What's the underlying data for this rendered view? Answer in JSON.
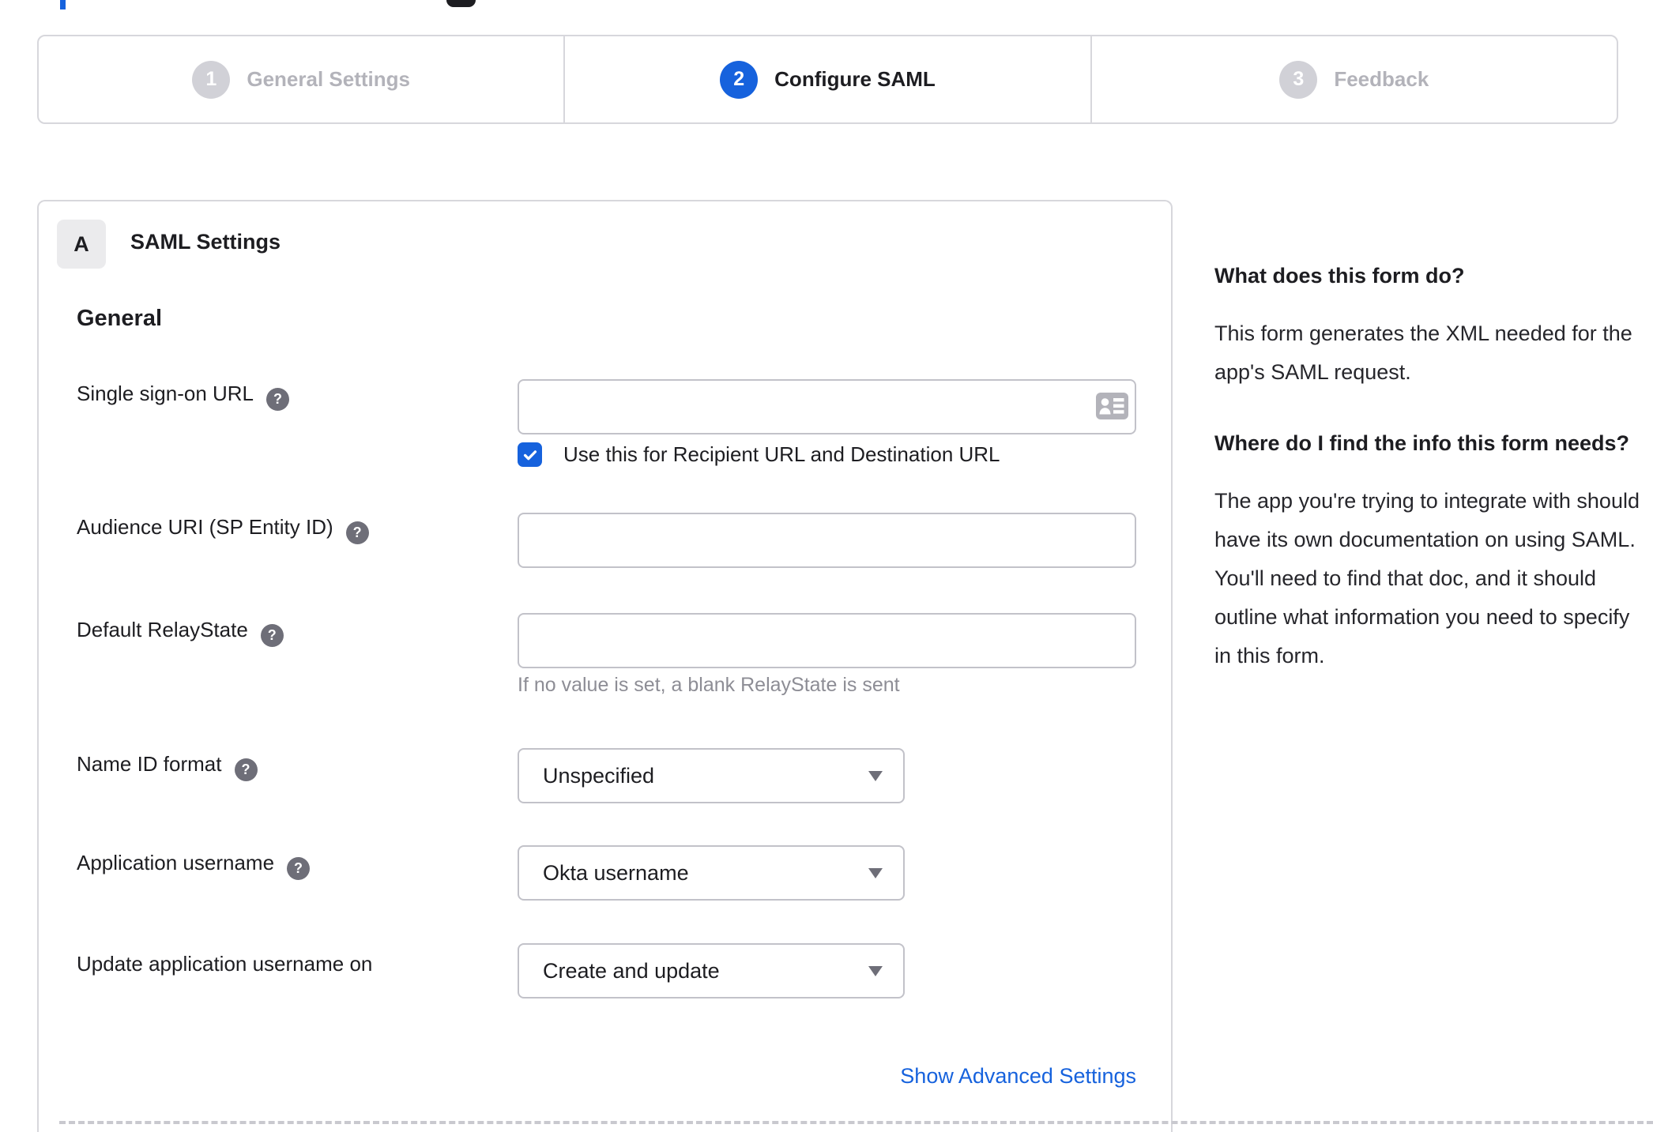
{
  "stepper": {
    "steps": [
      {
        "number": "1",
        "label": "General Settings",
        "state": "inactive"
      },
      {
        "number": "2",
        "label": "Configure SAML",
        "state": "active"
      },
      {
        "number": "3",
        "label": "Feedback",
        "state": "inactive"
      }
    ]
  },
  "panel": {
    "badge": "A",
    "title": "SAML Settings",
    "group_title": "General",
    "fields": {
      "sso": {
        "label": "Single sign-on URL",
        "value": "",
        "checkbox_checked": true,
        "checkbox_label": "Use this for Recipient URL and Destination URL"
      },
      "audience": {
        "label": "Audience URI (SP Entity ID)",
        "value": ""
      },
      "relay": {
        "label": "Default RelayState",
        "value": "",
        "hint": "If no value is set, a blank RelayState is sent"
      },
      "nameid": {
        "label": "Name ID format",
        "value": "Unspecified"
      },
      "appuser": {
        "label": "Application username",
        "value": "Okta username"
      },
      "updateuser": {
        "label": "Update application username on",
        "value": "Create and update"
      }
    },
    "advanced_link": "Show Advanced Settings"
  },
  "sidebar": {
    "heading1": "What does this form do?",
    "para1": "This form generates the XML needed for the app's SAML request.",
    "heading2": "Where do I find the info this form needs?",
    "para2": "The app you're trying to integrate with should have its own documentation on using SAML. You'll need to find that doc, and it should outline what information you need to specify in this form."
  },
  "ui": {
    "help_glyph": "?"
  },
  "colors": {
    "accent_blue": "#1662dd",
    "border_gray": "#d7d7dc",
    "input_border": "#c2c2c9",
    "inactive_step": "#d1d1d7",
    "inactive_text": "#b3b3ba",
    "text_dark": "#1d1d21",
    "hint_gray": "#8d8d95",
    "help_icon_gray": "#6e6e78",
    "badge_bg": "#ebebed"
  }
}
